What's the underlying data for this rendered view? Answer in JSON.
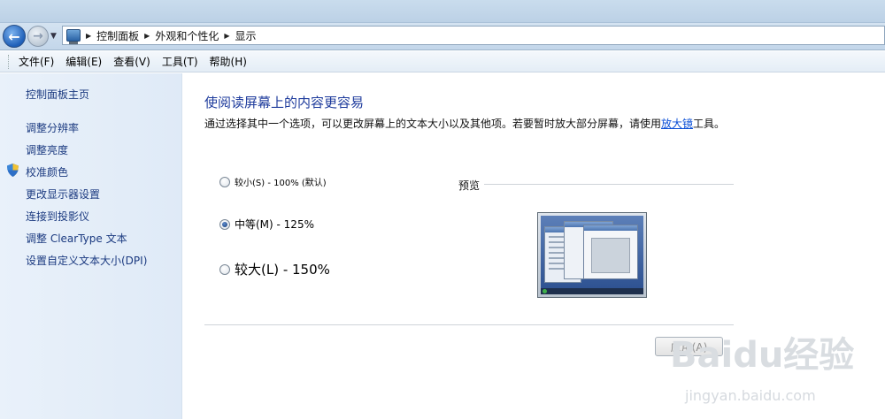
{
  "breadcrumb": [
    "控制面板",
    "外观和个性化",
    "显示"
  ],
  "menu": [
    "文件(F)",
    "编辑(E)",
    "查看(V)",
    "工具(T)",
    "帮助(H)"
  ],
  "sidebar": {
    "home": "控制面板主页",
    "links": [
      "调整分辨率",
      "调整亮度",
      "校准颜色",
      "更改显示器设置",
      "连接到投影仪",
      "调整 ClearType 文本",
      "设置自定义文本大小(DPI)"
    ]
  },
  "main": {
    "heading": "使阅读屏幕上的内容更容易",
    "desc_before": "通过选择其中一个选项，可以更改屏幕上的文本大小以及其他项。若要暂时放大部分屏幕，请使用",
    "desc_link": "放大镜",
    "desc_after": "工具。",
    "options": [
      {
        "label": "较小(S) - 100% (默认)",
        "checked": false
      },
      {
        "label": "中等(M) - 125%",
        "checked": true
      },
      {
        "label": "较大(L) - 150%",
        "checked": false
      }
    ],
    "preview_label": "预览",
    "apply": "应用(A)"
  },
  "watermark": {
    "logo": "Baidu经验",
    "url": "jingyan.baidu.com"
  }
}
